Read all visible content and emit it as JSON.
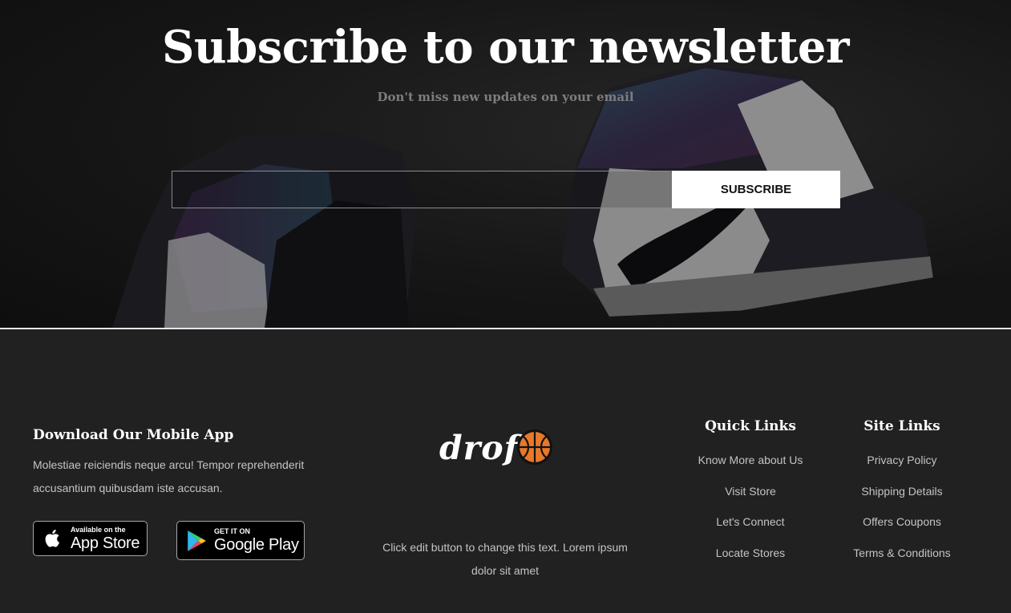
{
  "newsletter": {
    "title": "Subscribe to our newsletter",
    "subtitle": "Don't miss new updates on your email",
    "email_value": "",
    "email_placeholder": "",
    "subscribe_label": "SUBSCRIBE"
  },
  "footer": {
    "app": {
      "title": "Download Our Mobile App",
      "description": "Molestiae reiciendis neque arcu! Tempor reprehenderit accusantium quibusdam iste accusan.",
      "apple_small": "Available on the",
      "apple_big": "App Store",
      "google_small": "GET IT ON",
      "google_big": "Google Play"
    },
    "brand": {
      "logo_text": "drof",
      "description": "Click edit button to change this text. Lorem ipsum dolor sit amet"
    },
    "quick_links": {
      "title": "Quick Links",
      "items": [
        "Know More about Us",
        "Visit Store",
        "Let's Connect",
        "Locate Stores"
      ]
    },
    "site_links": {
      "title": "Site Links",
      "items": [
        "Privacy Policy",
        "Shipping Details",
        "Offers Coupons",
        "Terms & Conditions"
      ]
    }
  },
  "colors": {
    "background": "#212121",
    "text_muted": "#c4c4c4",
    "accent_ball": "#e8782a"
  }
}
